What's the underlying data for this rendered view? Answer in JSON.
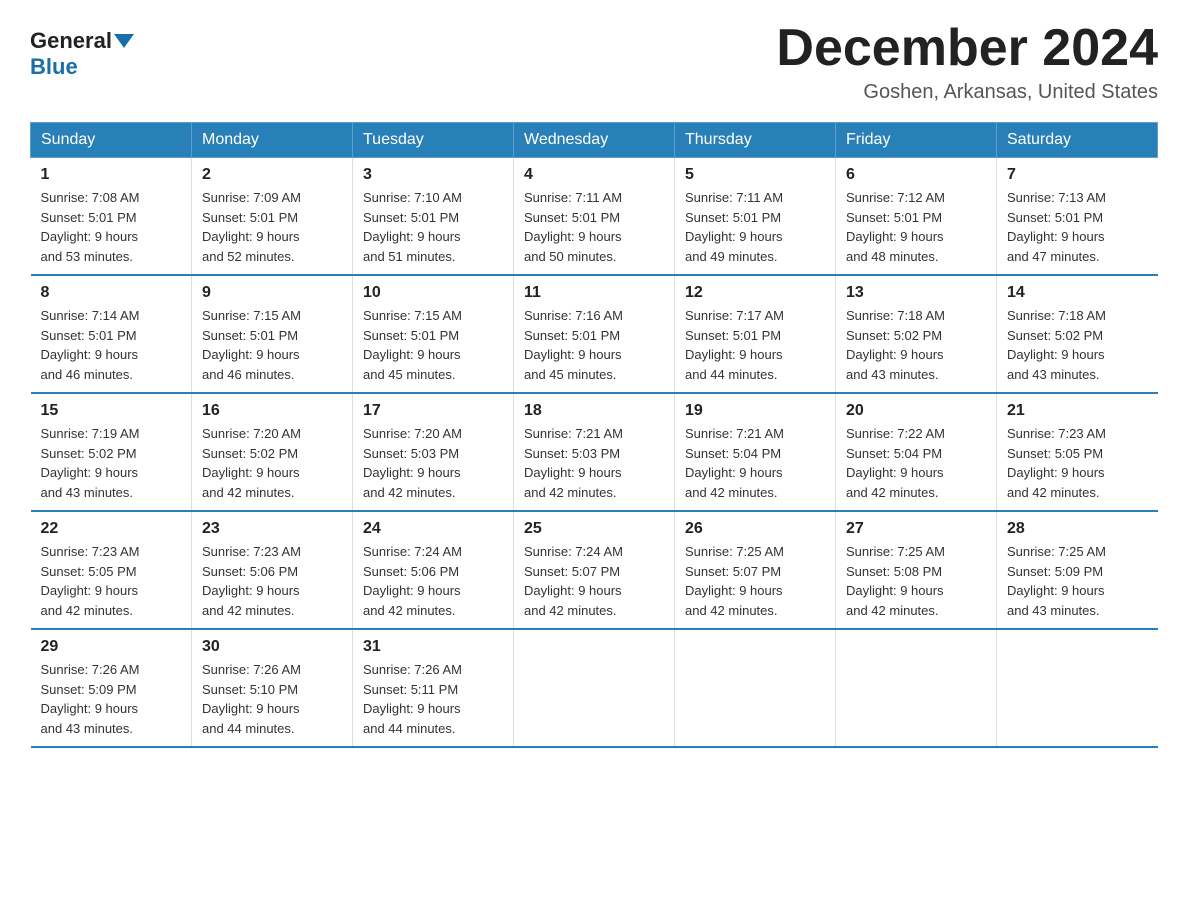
{
  "header": {
    "logo_general": "General",
    "logo_blue": "Blue",
    "month_title": "December 2024",
    "location": "Goshen, Arkansas, United States"
  },
  "days_of_week": [
    "Sunday",
    "Monday",
    "Tuesday",
    "Wednesday",
    "Thursday",
    "Friday",
    "Saturday"
  ],
  "weeks": [
    [
      {
        "date": "1",
        "sunrise": "7:08 AM",
        "sunset": "5:01 PM",
        "daylight": "9 hours and 53 minutes."
      },
      {
        "date": "2",
        "sunrise": "7:09 AM",
        "sunset": "5:01 PM",
        "daylight": "9 hours and 52 minutes."
      },
      {
        "date": "3",
        "sunrise": "7:10 AM",
        "sunset": "5:01 PM",
        "daylight": "9 hours and 51 minutes."
      },
      {
        "date": "4",
        "sunrise": "7:11 AM",
        "sunset": "5:01 PM",
        "daylight": "9 hours and 50 minutes."
      },
      {
        "date": "5",
        "sunrise": "7:11 AM",
        "sunset": "5:01 PM",
        "daylight": "9 hours and 49 minutes."
      },
      {
        "date": "6",
        "sunrise": "7:12 AM",
        "sunset": "5:01 PM",
        "daylight": "9 hours and 48 minutes."
      },
      {
        "date": "7",
        "sunrise": "7:13 AM",
        "sunset": "5:01 PM",
        "daylight": "9 hours and 47 minutes."
      }
    ],
    [
      {
        "date": "8",
        "sunrise": "7:14 AM",
        "sunset": "5:01 PM",
        "daylight": "9 hours and 46 minutes."
      },
      {
        "date": "9",
        "sunrise": "7:15 AM",
        "sunset": "5:01 PM",
        "daylight": "9 hours and 46 minutes."
      },
      {
        "date": "10",
        "sunrise": "7:15 AM",
        "sunset": "5:01 PM",
        "daylight": "9 hours and 45 minutes."
      },
      {
        "date": "11",
        "sunrise": "7:16 AM",
        "sunset": "5:01 PM",
        "daylight": "9 hours and 45 minutes."
      },
      {
        "date": "12",
        "sunrise": "7:17 AM",
        "sunset": "5:01 PM",
        "daylight": "9 hours and 44 minutes."
      },
      {
        "date": "13",
        "sunrise": "7:18 AM",
        "sunset": "5:02 PM",
        "daylight": "9 hours and 43 minutes."
      },
      {
        "date": "14",
        "sunrise": "7:18 AM",
        "sunset": "5:02 PM",
        "daylight": "9 hours and 43 minutes."
      }
    ],
    [
      {
        "date": "15",
        "sunrise": "7:19 AM",
        "sunset": "5:02 PM",
        "daylight": "9 hours and 43 minutes."
      },
      {
        "date": "16",
        "sunrise": "7:20 AM",
        "sunset": "5:02 PM",
        "daylight": "9 hours and 42 minutes."
      },
      {
        "date": "17",
        "sunrise": "7:20 AM",
        "sunset": "5:03 PM",
        "daylight": "9 hours and 42 minutes."
      },
      {
        "date": "18",
        "sunrise": "7:21 AM",
        "sunset": "5:03 PM",
        "daylight": "9 hours and 42 minutes."
      },
      {
        "date": "19",
        "sunrise": "7:21 AM",
        "sunset": "5:04 PM",
        "daylight": "9 hours and 42 minutes."
      },
      {
        "date": "20",
        "sunrise": "7:22 AM",
        "sunset": "5:04 PM",
        "daylight": "9 hours and 42 minutes."
      },
      {
        "date": "21",
        "sunrise": "7:23 AM",
        "sunset": "5:05 PM",
        "daylight": "9 hours and 42 minutes."
      }
    ],
    [
      {
        "date": "22",
        "sunrise": "7:23 AM",
        "sunset": "5:05 PM",
        "daylight": "9 hours and 42 minutes."
      },
      {
        "date": "23",
        "sunrise": "7:23 AM",
        "sunset": "5:06 PM",
        "daylight": "9 hours and 42 minutes."
      },
      {
        "date": "24",
        "sunrise": "7:24 AM",
        "sunset": "5:06 PM",
        "daylight": "9 hours and 42 minutes."
      },
      {
        "date": "25",
        "sunrise": "7:24 AM",
        "sunset": "5:07 PM",
        "daylight": "9 hours and 42 minutes."
      },
      {
        "date": "26",
        "sunrise": "7:25 AM",
        "sunset": "5:07 PM",
        "daylight": "9 hours and 42 minutes."
      },
      {
        "date": "27",
        "sunrise": "7:25 AM",
        "sunset": "5:08 PM",
        "daylight": "9 hours and 42 minutes."
      },
      {
        "date": "28",
        "sunrise": "7:25 AM",
        "sunset": "5:09 PM",
        "daylight": "9 hours and 43 minutes."
      }
    ],
    [
      {
        "date": "29",
        "sunrise": "7:26 AM",
        "sunset": "5:09 PM",
        "daylight": "9 hours and 43 minutes."
      },
      {
        "date": "30",
        "sunrise": "7:26 AM",
        "sunset": "5:10 PM",
        "daylight": "9 hours and 44 minutes."
      },
      {
        "date": "31",
        "sunrise": "7:26 AM",
        "sunset": "5:11 PM",
        "daylight": "9 hours and 44 minutes."
      },
      {
        "date": "",
        "sunrise": "",
        "sunset": "",
        "daylight": ""
      },
      {
        "date": "",
        "sunrise": "",
        "sunset": "",
        "daylight": ""
      },
      {
        "date": "",
        "sunrise": "",
        "sunset": "",
        "daylight": ""
      },
      {
        "date": "",
        "sunrise": "",
        "sunset": "",
        "daylight": ""
      }
    ]
  ],
  "labels": {
    "sunrise": "Sunrise:",
    "sunset": "Sunset:",
    "daylight": "Daylight:"
  }
}
